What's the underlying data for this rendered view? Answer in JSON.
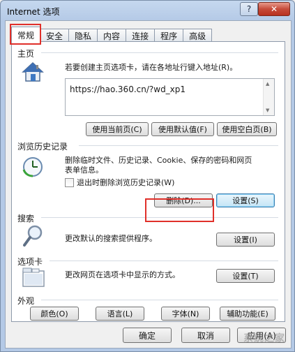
{
  "window": {
    "title": "Internet 选项",
    "help_label": "?",
    "close_label": "✕"
  },
  "tabs": [
    {
      "label": "常规",
      "active": true
    },
    {
      "label": "安全"
    },
    {
      "label": "隐私"
    },
    {
      "label": "内容"
    },
    {
      "label": "连接"
    },
    {
      "label": "程序"
    },
    {
      "label": "高级"
    }
  ],
  "homepage": {
    "title": "主页",
    "description": "若要创建主页选项卡，请在各地址行键入地址(R)。",
    "url_value": "https://hao.360.cn/?wd_xp1",
    "buttons": {
      "use_current": "使用当前页(C)",
      "use_default": "使用默认值(F)",
      "use_blank": "使用空白页(B)"
    }
  },
  "history": {
    "title": "浏览历史记录",
    "description_line1": "删除临时文件、历史记录、Cookie、保存的密码和网页",
    "description_line2": "表单信息。",
    "checkbox_label": "退出时删除浏览历史记录(W)",
    "delete_button": "删除(D)...",
    "settings_button": "设置(S)"
  },
  "search": {
    "title": "搜索",
    "description": "更改默认的搜索提供程序。",
    "settings_button": "设置(I)"
  },
  "tabsection": {
    "title": "选项卡",
    "description": "更改网页在选项卡中显示的方式。",
    "settings_button": "设置(T)"
  },
  "appearance": {
    "title": "外观",
    "colors": "颜色(O)",
    "languages": "语言(L)",
    "fonts": "字体(N)",
    "accessibility": "辅助功能(E)"
  },
  "footer": {
    "ok": "确定",
    "cancel": "取消",
    "apply": "应用(A)"
  },
  "watermark": "系统之家",
  "colors": {
    "highlight_red": "#e0302a",
    "title_bar": "#b4c9e6",
    "focus_blue": "#3c7fb1"
  }
}
